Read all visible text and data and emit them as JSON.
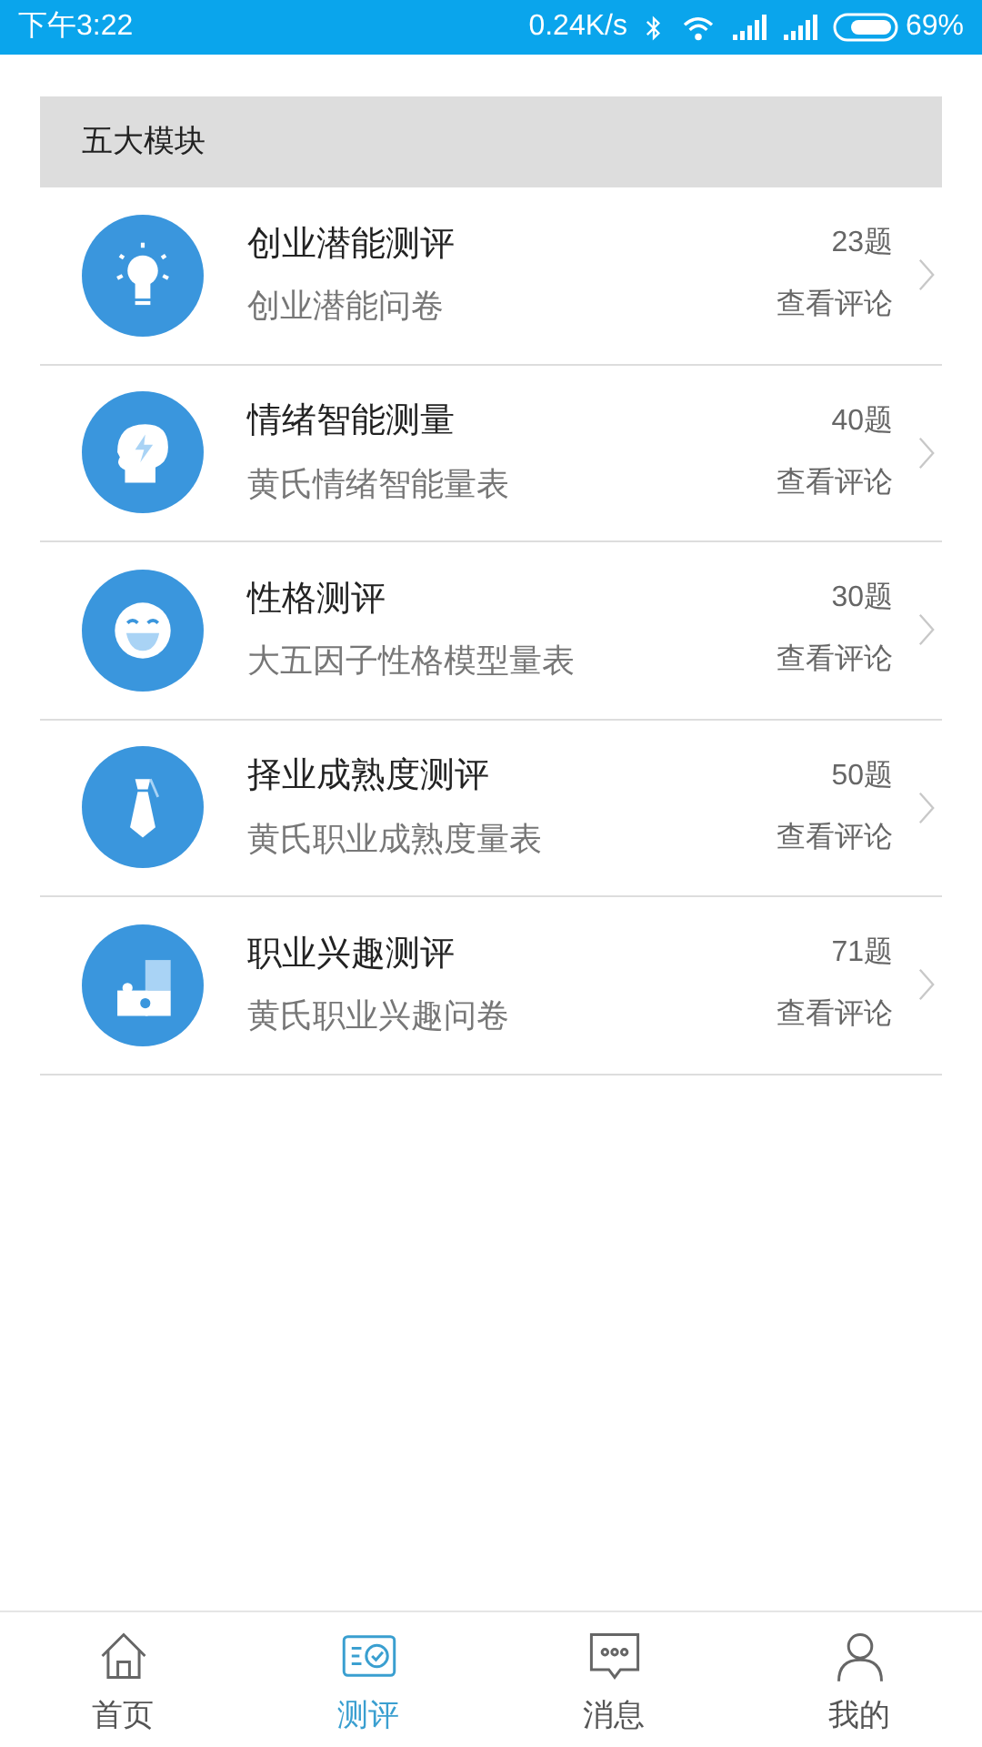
{
  "status_bar": {
    "time": "下午3:22",
    "speed": "0.24K/s",
    "battery": "69%"
  },
  "section": {
    "title": "五大模块"
  },
  "modules": [
    {
      "title": "创业潜能测评",
      "subtitle": "创业潜能问卷",
      "count": "23题",
      "link": "查看评论"
    },
    {
      "title": "情绪智能测量",
      "subtitle": "黄氏情绪智能量表",
      "count": "40题",
      "link": "查看评论"
    },
    {
      "title": "性格测评",
      "subtitle": "大五因子性格模型量表",
      "count": "30题",
      "link": "查看评论"
    },
    {
      "title": "择业成熟度测评",
      "subtitle": "黄氏职业成熟度量表",
      "count": "50题",
      "link": "查看评论"
    },
    {
      "title": "职业兴趣测评",
      "subtitle": "黄氏职业兴趣问卷",
      "count": "71题",
      "link": "查看评论"
    }
  ],
  "tabs": [
    {
      "label": "首页",
      "selected": false
    },
    {
      "label": "测评",
      "selected": true
    },
    {
      "label": "消息",
      "selected": false
    },
    {
      "label": "我的",
      "selected": false
    }
  ]
}
